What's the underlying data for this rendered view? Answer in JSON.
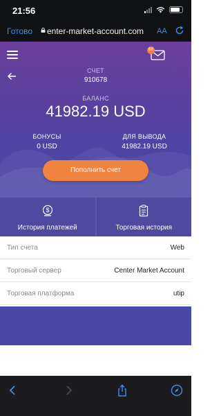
{
  "status_bar": {
    "time": "21:56"
  },
  "browser": {
    "done_label": "Готово",
    "url": "enter-market-account.com",
    "text_size_label": "AA"
  },
  "header": {
    "account_label": "СЧЕТ",
    "account_number": "910678",
    "balance_label": "БАЛАНС",
    "balance_value": "41982.19 USD",
    "bonus_label": "БОНУСЫ",
    "bonus_value": "0 USD",
    "withdraw_label": "ДЛЯ ВЫВОДА",
    "withdraw_value": "41982.19 USD",
    "topup_label": "Пополнить счет",
    "mail_badge": "68"
  },
  "tiles": [
    {
      "label": "История платежей",
      "icon": "dollar-coin-icon"
    },
    {
      "label": "Торговая история",
      "icon": "clipboard-icon"
    }
  ],
  "info_rows": [
    {
      "key": "Тип счета",
      "value": "Web"
    },
    {
      "key": "Торговый сервер",
      "value": "Center Market Account"
    },
    {
      "key": "Торговая платформа",
      "value": "utip"
    }
  ],
  "colors": {
    "accent": "#f08340",
    "header_top": "#6b3f9c",
    "header_bottom": "#4a48a6",
    "ios_blue": "#3d8ff2"
  }
}
